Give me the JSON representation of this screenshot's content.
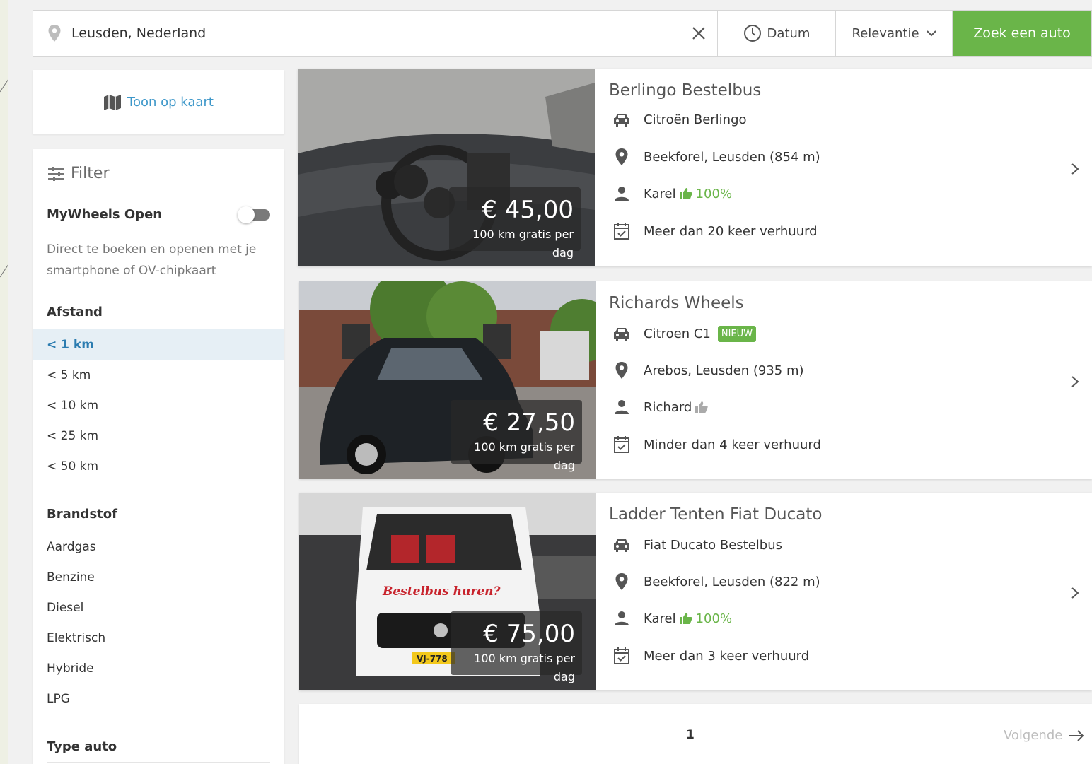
{
  "search": {
    "location_value": "Leusden, Nederland",
    "date_label": "Datum",
    "sort_label": "Relevantie",
    "search_button": "Zoek een auto"
  },
  "sidebar": {
    "map_link": "Toon op kaart",
    "filter_title": "Filter",
    "mywheels_open": {
      "label": "MyWheels Open",
      "enabled": false,
      "description": "Direct te boeken en openen met je smartphone of OV-chipkaart"
    },
    "distance": {
      "heading": "Afstand",
      "options": [
        "< 1 km",
        "< 5 km",
        "< 10 km",
        "< 25 km",
        "< 50 km"
      ],
      "selected": "< 1 km"
    },
    "fuel": {
      "heading": "Brandstof",
      "options": [
        "Aardgas",
        "Benzine",
        "Diesel",
        "Elektrisch",
        "Hybride",
        "LPG"
      ]
    },
    "type_heading": "Type auto"
  },
  "listings": [
    {
      "title": "Berlingo Bestelbus",
      "model": "Citroën Berlingo",
      "badge": "",
      "location": "Beekforel, Leusden (854 m)",
      "owner": "Karel",
      "rating": "100%",
      "rentals": "Meer dan 20 keer verhuurd",
      "price": "€ 45,00",
      "km_note": "100 km gratis per dag"
    },
    {
      "title": "Richards Wheels",
      "model": "Citroen C1",
      "badge": "NIEUW",
      "location": "Arebos, Leusden (935 m)",
      "owner": "Richard",
      "rating": "",
      "rentals": "Minder dan 4 keer verhuurd",
      "price": "€ 27,50",
      "km_note": "100 km gratis per dag"
    },
    {
      "title": "Ladder Tenten Fiat Ducato",
      "model": "Fiat Ducato Bestelbus",
      "badge": "",
      "location": "Beekforel, Leusden (822 m)",
      "owner": "Karel",
      "rating": "100%",
      "rentals": "Meer dan 3 keer verhuurd",
      "price": "€ 75,00",
      "km_note": "100 km gratis per dag",
      "photo_text": "Bestelbus huren?",
      "plate_text": "VJ-778"
    }
  ],
  "pagination": {
    "current_page": "1",
    "next_label": "Volgende"
  },
  "colors": {
    "accent_green": "#6ab549",
    "link_blue": "#3d97c9",
    "selected_bg": "#e6eff5"
  },
  "icons": [
    "map-pin-icon",
    "close-icon",
    "clock-icon",
    "chevron-down-icon",
    "map-icon",
    "filter-sliders-icon",
    "car-icon",
    "user-icon",
    "calendar-check-icon",
    "thumbs-up-icon",
    "chevron-right-icon",
    "arrow-right-icon"
  ]
}
